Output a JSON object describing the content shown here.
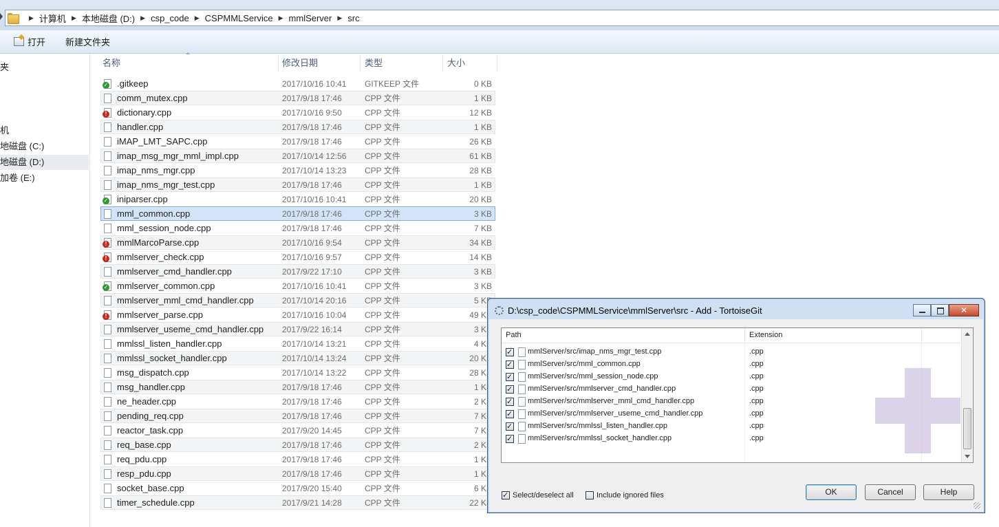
{
  "address": {
    "crumbs": [
      "计算机",
      "本地磁盘 (D:)",
      "csp_code",
      "CSPMMLService",
      "mmlServer",
      "src"
    ]
  },
  "toolbar": {
    "open_label": "打开",
    "new_folder_label": "新建文件夹"
  },
  "navpane": {
    "items": [
      "夹",
      "机",
      "地磁盘 (C:)",
      "地磁盘 (D:)",
      "加卷 (E:)"
    ]
  },
  "columns": {
    "name": "名称",
    "date": "修改日期",
    "type": "类型",
    "size": "大小"
  },
  "files": [
    {
      "name": ".gitkeep",
      "date": "2017/10/16 10:41",
      "type": "GITKEEP 文件",
      "size": "0 KB",
      "status": "ok"
    },
    {
      "name": "comm_mutex.cpp",
      "date": "2017/9/18 17:46",
      "type": "CPP 文件",
      "size": "1 KB",
      "status": "none"
    },
    {
      "name": "dictionary.cpp",
      "date": "2017/10/16 9:50",
      "type": "CPP 文件",
      "size": "12 KB",
      "status": "mod"
    },
    {
      "name": "handler.cpp",
      "date": "2017/9/18 17:46",
      "type": "CPP 文件",
      "size": "1 KB",
      "status": "none"
    },
    {
      "name": "iMAP_LMT_SAPC.cpp",
      "date": "2017/9/18 17:46",
      "type": "CPP 文件",
      "size": "26 KB",
      "status": "none"
    },
    {
      "name": "imap_msg_mgr_mml_impl.cpp",
      "date": "2017/10/14 12:56",
      "type": "CPP 文件",
      "size": "61 KB",
      "status": "none"
    },
    {
      "name": "imap_nms_mgr.cpp",
      "date": "2017/10/14 13:23",
      "type": "CPP 文件",
      "size": "28 KB",
      "status": "none"
    },
    {
      "name": "imap_nms_mgr_test.cpp",
      "date": "2017/9/18 17:46",
      "type": "CPP 文件",
      "size": "1 KB",
      "status": "none"
    },
    {
      "name": "iniparser.cpp",
      "date": "2017/10/16 10:41",
      "type": "CPP 文件",
      "size": "20 KB",
      "status": "ok"
    },
    {
      "name": "mml_common.cpp",
      "date": "2017/9/18 17:46",
      "type": "CPP 文件",
      "size": "3 KB",
      "status": "none",
      "selected": true
    },
    {
      "name": "mml_session_node.cpp",
      "date": "2017/9/18 17:46",
      "type": "CPP 文件",
      "size": "7 KB",
      "status": "none"
    },
    {
      "name": "mmlMarcoParse.cpp",
      "date": "2017/10/16 9:54",
      "type": "CPP 文件",
      "size": "34 KB",
      "status": "mod"
    },
    {
      "name": "mmlserver_check.cpp",
      "date": "2017/10/16 9:57",
      "type": "CPP 文件",
      "size": "14 KB",
      "status": "mod"
    },
    {
      "name": "mmlserver_cmd_handler.cpp",
      "date": "2017/9/22 17:10",
      "type": "CPP 文件",
      "size": "3 KB",
      "status": "none"
    },
    {
      "name": "mmlserver_common.cpp",
      "date": "2017/10/16 10:41",
      "type": "CPP 文件",
      "size": "3 KB",
      "status": "ok"
    },
    {
      "name": "mmlserver_mml_cmd_handler.cpp",
      "date": "2017/10/14 20:16",
      "type": "CPP 文件",
      "size": "5 KB",
      "status": "none"
    },
    {
      "name": "mmlserver_parse.cpp",
      "date": "2017/10/16 10:04",
      "type": "CPP 文件",
      "size": "49 KB",
      "status": "mod"
    },
    {
      "name": "mmlserver_useme_cmd_handler.cpp",
      "date": "2017/9/22 16:14",
      "type": "CPP 文件",
      "size": "3 KB",
      "status": "none"
    },
    {
      "name": "mmlssl_listen_handler.cpp",
      "date": "2017/10/14 13:21",
      "type": "CPP 文件",
      "size": "4 KB",
      "status": "none"
    },
    {
      "name": "mmlssl_socket_handler.cpp",
      "date": "2017/10/14 13:24",
      "type": "CPP 文件",
      "size": "20 KB",
      "status": "none"
    },
    {
      "name": "msg_dispatch.cpp",
      "date": "2017/10/14 13:22",
      "type": "CPP 文件",
      "size": "28 KB",
      "status": "none"
    },
    {
      "name": "msg_handler.cpp",
      "date": "2017/9/18 17:46",
      "type": "CPP 文件",
      "size": "1 KB",
      "status": "none"
    },
    {
      "name": "ne_header.cpp",
      "date": "2017/9/18 17:46",
      "type": "CPP 文件",
      "size": "2 KB",
      "status": "none"
    },
    {
      "name": "pending_req.cpp",
      "date": "2017/9/18 17:46",
      "type": "CPP 文件",
      "size": "7 KB",
      "status": "none"
    },
    {
      "name": "reactor_task.cpp",
      "date": "2017/9/20 14:45",
      "type": "CPP 文件",
      "size": "7 KB",
      "status": "none"
    },
    {
      "name": "req_base.cpp",
      "date": "2017/9/18 17:46",
      "type": "CPP 文件",
      "size": "2 KB",
      "status": "none"
    },
    {
      "name": "req_pdu.cpp",
      "date": "2017/9/18 17:46",
      "type": "CPP 文件",
      "size": "1 KB",
      "status": "none"
    },
    {
      "name": "resp_pdu.cpp",
      "date": "2017/9/18 17:46",
      "type": "CPP 文件",
      "size": "1 KB",
      "status": "none"
    },
    {
      "name": "socket_base.cpp",
      "date": "2017/9/20 15:40",
      "type": "CPP 文件",
      "size": "6 KB",
      "status": "none"
    },
    {
      "name": "timer_schedule.cpp",
      "date": "2017/9/21 14:28",
      "type": "CPP 文件",
      "size": "22 KB",
      "status": "none"
    }
  ],
  "dialog": {
    "title": "D:\\csp_code\\CSPMMLService\\mmlServer\\src - Add - TortoiseGit",
    "col_path": "Path",
    "col_ext": "Extension",
    "rows": [
      {
        "path": "mmlServer/src/imap_nms_mgr_test.cpp",
        "ext": ".cpp",
        "checked": true
      },
      {
        "path": "mmlServer/src/mml_common.cpp",
        "ext": ".cpp",
        "checked": true
      },
      {
        "path": "mmlServer/src/mml_session_node.cpp",
        "ext": ".cpp",
        "checked": true
      },
      {
        "path": "mmlServer/src/mmlserver_cmd_handler.cpp",
        "ext": ".cpp",
        "checked": true
      },
      {
        "path": "mmlServer/src/mmlserver_mml_cmd_handler.cpp",
        "ext": ".cpp",
        "checked": true
      },
      {
        "path": "mmlServer/src/mmlserver_useme_cmd_handler.cpp",
        "ext": ".cpp",
        "checked": true
      },
      {
        "path": "mmlServer/src/mmlssl_listen_handler.cpp",
        "ext": ".cpp",
        "checked": true
      },
      {
        "path": "mmlServer/src/mmlssl_socket_handler.cpp",
        "ext": ".cpp",
        "checked": true
      }
    ],
    "select_all_label": "Select/deselect all",
    "select_all_checked": true,
    "include_ignored_label": "Include ignored files",
    "include_ignored_checked": false,
    "ok_label": "OK",
    "cancel_label": "Cancel",
    "help_label": "Help"
  }
}
